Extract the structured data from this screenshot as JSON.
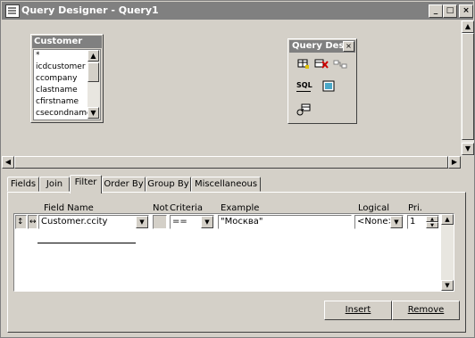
{
  "window": {
    "title": "Query Designer - Query1",
    "min_symbol": "_",
    "max_symbol": "□",
    "close_symbol": "×"
  },
  "customer_table": {
    "title": "Customer",
    "fields": [
      "*",
      "icdcustomer",
      "ccompany",
      "clastname",
      "cfirstname",
      "csecondname"
    ]
  },
  "toolbox": {
    "title": "Query Desi",
    "close_symbol": "×",
    "sql_label": "SQL"
  },
  "scroll": {
    "up": "▲",
    "down": "▼",
    "left": "◀",
    "right": "▶"
  },
  "tabs": [
    {
      "label": "Fields"
    },
    {
      "label": "Join"
    },
    {
      "label": "Filter"
    },
    {
      "label": "Order By"
    },
    {
      "label": "Group By"
    },
    {
      "label": "Miscellaneous"
    }
  ],
  "active_tab": "Filter",
  "filter": {
    "headers": {
      "field_name": "Field Name",
      "not": "Not",
      "criteria": "Criteria",
      "example": "Example",
      "logical": "Logical",
      "priority": "Pri."
    },
    "row_icons": {
      "move": "↕",
      "insert": "↔"
    },
    "row": {
      "field_name": "Customer.ccity",
      "criteria": "==",
      "example": "\"Москва\"",
      "logical": "<None>",
      "priority": "1"
    },
    "arrow_down": "▼",
    "spin_up": "▲",
    "spin_down": "▼"
  },
  "buttons": {
    "insert": "Insert",
    "remove": "Remove"
  }
}
